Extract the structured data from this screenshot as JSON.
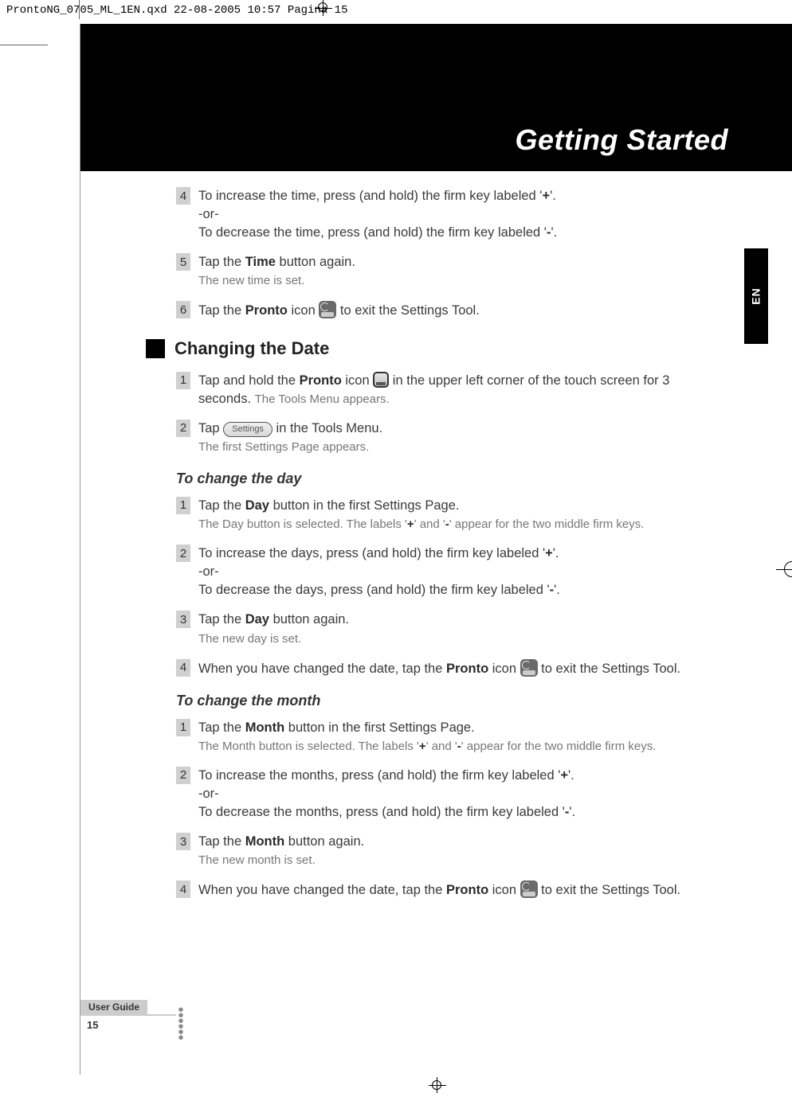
{
  "header_strip": "ProntoNG_0705_ML_1EN.qxd  22-08-2005  10:57  Pagina 15",
  "banner_title": "Getting Started",
  "side_tab": "EN",
  "time_section": {
    "step4": {
      "line1_a": "To increase the time, press (and hold) the firm key labeled '",
      "line1_b": "+",
      "line1_c": "'.",
      "or": "-or-",
      "line2_a": "To decrease the time, press (and hold) the firm key labeled '",
      "line2_b": "-",
      "line2_c": "'."
    },
    "step5": {
      "line1_a": "Tap the ",
      "line1_b": "Time",
      "line1_c": " button again.",
      "sub": "The new time is set."
    },
    "step6": {
      "a": "Tap the ",
      "b": "Pronto",
      "c": " icon ",
      "d": " to exit the Settings Tool."
    }
  },
  "h2_date": "Changing the Date",
  "date_section": {
    "step1": {
      "a": "Tap and hold the ",
      "b": "Pronto",
      "c": " icon ",
      "d": " in the upper left corner of the touch screen for 3 seconds. ",
      "sub": "The Tools Menu appears."
    },
    "step2": {
      "a": "Tap ",
      "pill": "Settings",
      "b": " in the Tools Menu.",
      "sub": "The first Settings Page appears."
    }
  },
  "h3_day": "To change the day",
  "day_section": {
    "step1": {
      "a": "Tap the ",
      "b": "Day",
      "c": " button in the first Settings Page.",
      "sub_a": "The Day button is selected. The labels '",
      "sub_b": "+",
      "sub_c": "' and '",
      "sub_d": "-",
      "sub_e": "' appear for the two middle firm keys."
    },
    "step2": {
      "line1_a": "To increase the days, press (and hold) the firm key labeled '",
      "line1_b": "+",
      "line1_c": "'.",
      "or": "-or-",
      "line2_a": "To decrease the days, press (and hold) the firm key labeled '",
      "line2_b": "-",
      "line2_c": "'."
    },
    "step3": {
      "a": "Tap the ",
      "b": "Day",
      "c": " button again.",
      "sub": "The new day is set."
    },
    "step4": {
      "a": "When you have changed the date, tap the ",
      "b": "Pronto",
      "c": " icon ",
      "d": " to exit the Settings Tool."
    }
  },
  "h3_month": "To change the month",
  "month_section": {
    "step1": {
      "a": "Tap the ",
      "b": "Month",
      "c": " button in the first Settings Page.",
      "sub_a": "The Month button is selected. The labels '",
      "sub_b": "+",
      "sub_c": "' and '",
      "sub_d": "-",
      "sub_e": "' appear for the two middle firm keys."
    },
    "step2": {
      "line1_a": "To increase the months, press (and hold) the firm key labeled '",
      "line1_b": "+",
      "line1_c": "'.",
      "or": "-or-",
      "line2_a": "To decrease the months, press (and hold) the firm key labeled '",
      "line2_b": "-",
      "line2_c": "'."
    },
    "step3": {
      "a": "Tap the ",
      "b": "Month",
      "c": " button again.",
      "sub": "The new month is set."
    },
    "step4": {
      "a": "When you have changed the date, tap the ",
      "b": "Pronto",
      "c": " icon ",
      "d": " to exit the Settings Tool."
    }
  },
  "footer": {
    "label": "User Guide",
    "page": "15"
  },
  "nums": {
    "n1": "1",
    "n2": "2",
    "n3": "3",
    "n4": "4",
    "n5": "5",
    "n6": "6"
  }
}
